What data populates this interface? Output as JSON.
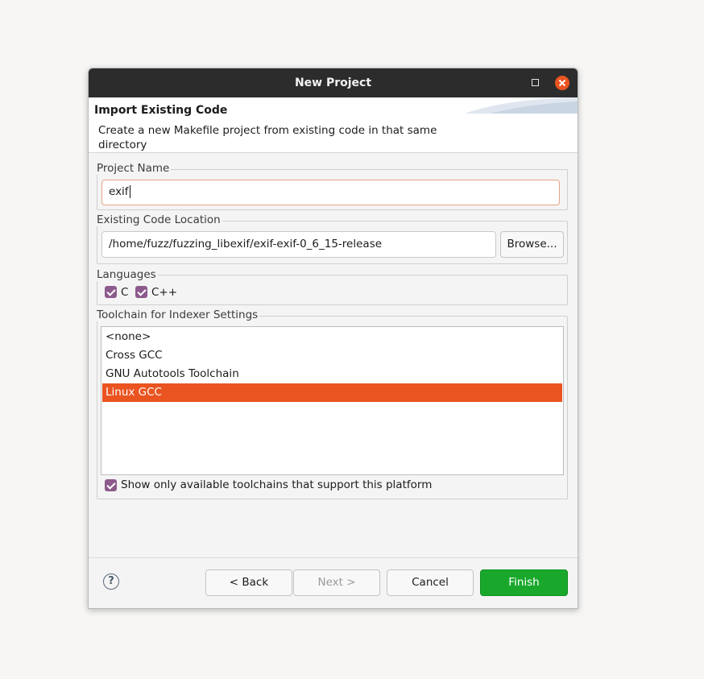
{
  "window": {
    "title": "New Project"
  },
  "banner": {
    "heading": "Import Existing Code",
    "description": "Create a new Makefile project from existing code in that same directory"
  },
  "project_name": {
    "label": "Project Name",
    "value": "exif"
  },
  "code_location": {
    "label": "Existing Code Location",
    "value": "/home/fuzz/fuzzing_libexif/exif-exif-0_6_15-release",
    "browse_label": "Browse..."
  },
  "languages": {
    "label": "Languages",
    "items": [
      {
        "label": "C",
        "checked": true
      },
      {
        "label": "C++",
        "checked": true
      }
    ]
  },
  "toolchain": {
    "label": "Toolchain for Indexer Settings",
    "items": [
      "<none>",
      "Cross GCC",
      "GNU Autotools Toolchain",
      "Linux GCC"
    ],
    "selected": "Linux GCC",
    "filter_label": "Show only available toolchains that support this platform",
    "filter_checked": true
  },
  "footer": {
    "help_glyph": "?",
    "back_label": "< Back",
    "next_label": "Next >",
    "cancel_label": "Cancel",
    "finish_label": "Finish"
  },
  "colors": {
    "accent": "#e95420",
    "finish": "#19a82c",
    "checkbox": "#8c5a8c",
    "titlebar": "#2c2c2c"
  }
}
